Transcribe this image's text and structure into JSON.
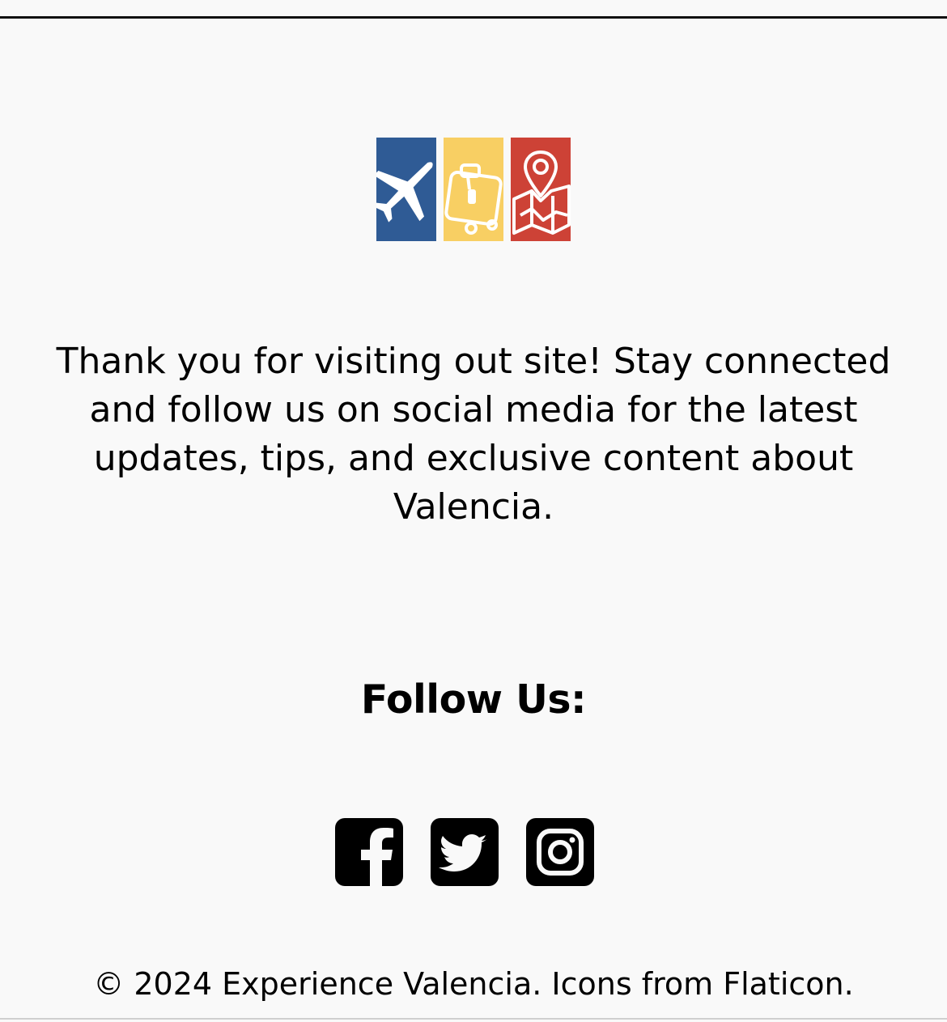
{
  "footer": {
    "message": "Thank you for visiting out site! Stay connected and follow us on social media for the latest updates, tips, and exclusive content about Valencia.",
    "follow_title": "Follow Us:",
    "copyright": "© 2024 Experience Valencia. Icons from Flaticon."
  },
  "logo": {
    "tiles": [
      {
        "icon": "airplane-icon",
        "color": "#2f5b95"
      },
      {
        "icon": "suitcase-icon",
        "color": "#f8cf63"
      },
      {
        "icon": "map-pin-icon",
        "color": "#cd4236"
      }
    ]
  },
  "social": [
    {
      "icon": "facebook-icon"
    },
    {
      "icon": "twitter-icon"
    },
    {
      "icon": "instagram-icon"
    }
  ],
  "colors": {
    "background": "#f9f9f9",
    "text": "#000000"
  }
}
